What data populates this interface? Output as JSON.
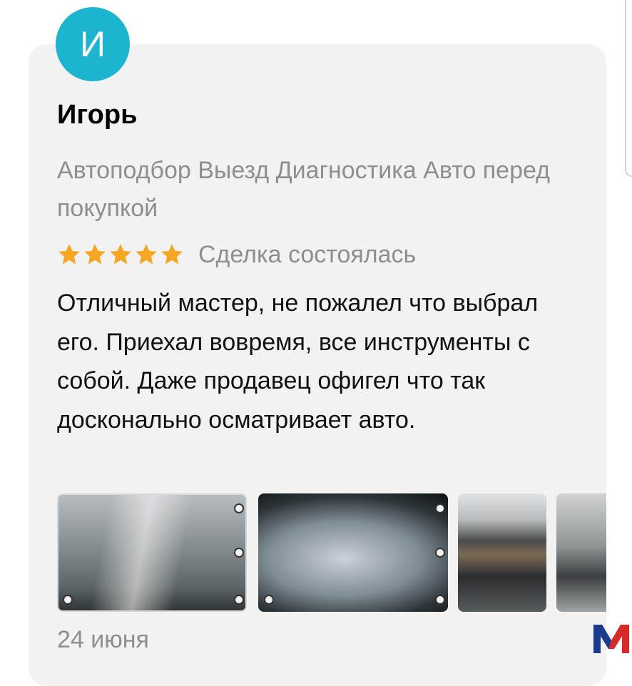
{
  "review": {
    "avatar_letter": "И",
    "avatar_color": "#1cb5cf",
    "author": "Игорь",
    "service": "Автоподбор Выезд Диагностика Авто перед покупкой",
    "rating": 5,
    "rating_max": 5,
    "star_color": "#f5a623",
    "status": "Сделка состоялась",
    "text": "Отличный мастер, не пожалел что выбрал его. Приехал вовремя, все инструменты с собой. Даже продавец офигел что так досконально осматривает авто.",
    "date": "24 июня",
    "photos": [
      "photo-1",
      "photo-2",
      "photo-3",
      "photo-4"
    ]
  },
  "watermark": {
    "letter": "M"
  }
}
